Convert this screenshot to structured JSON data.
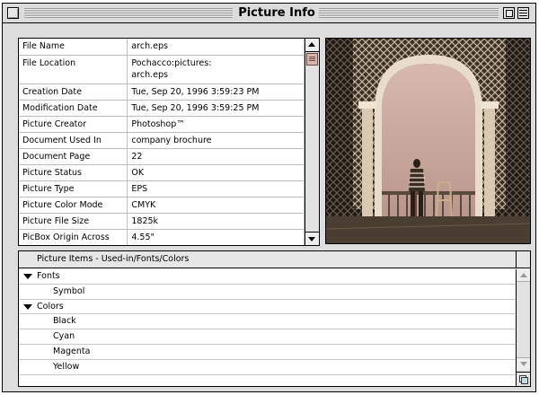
{
  "window": {
    "title": "Picture Info"
  },
  "info": {
    "rows": [
      {
        "label": "File Name",
        "value": "arch.eps"
      },
      {
        "label": "File Location",
        "value": "Pochacco:pictures:\narch.eps"
      },
      {
        "label": "Creation Date",
        "value": "Tue, Sep 20, 1996  3:59:23 PM"
      },
      {
        "label": "Modification Date",
        "value": "Tue, Sep 20, 1996  3:59:25 PM"
      },
      {
        "label": "Picture Creator",
        "value": "Photoshop™"
      },
      {
        "label": "Document Used In",
        "value": "company brochure"
      },
      {
        "label": "Document Page",
        "value": "22"
      },
      {
        "label": "Picture Status",
        "value": "OK"
      },
      {
        "label": "Picture Type",
        "value": "EPS"
      },
      {
        "label": "Picture Color Mode",
        "value": "CMYK"
      },
      {
        "label": "Picture File Size",
        "value": "1825k"
      },
      {
        "label": "PicBox Origin Across",
        "value": "4.55\""
      }
    ]
  },
  "items": {
    "header": "Picture Items - Used-in/Fonts/Colors",
    "groups": [
      {
        "label": "Fonts",
        "children": [
          "Symbol"
        ]
      },
      {
        "label": "Colors",
        "children": [
          "Black",
          "Cyan",
          "Magenta",
          "Yellow"
        ]
      }
    ]
  },
  "colors": {
    "window_bg": "#dddddd",
    "scroll_thumb": "#d9b4a8",
    "sky": "#c9a9a0"
  }
}
